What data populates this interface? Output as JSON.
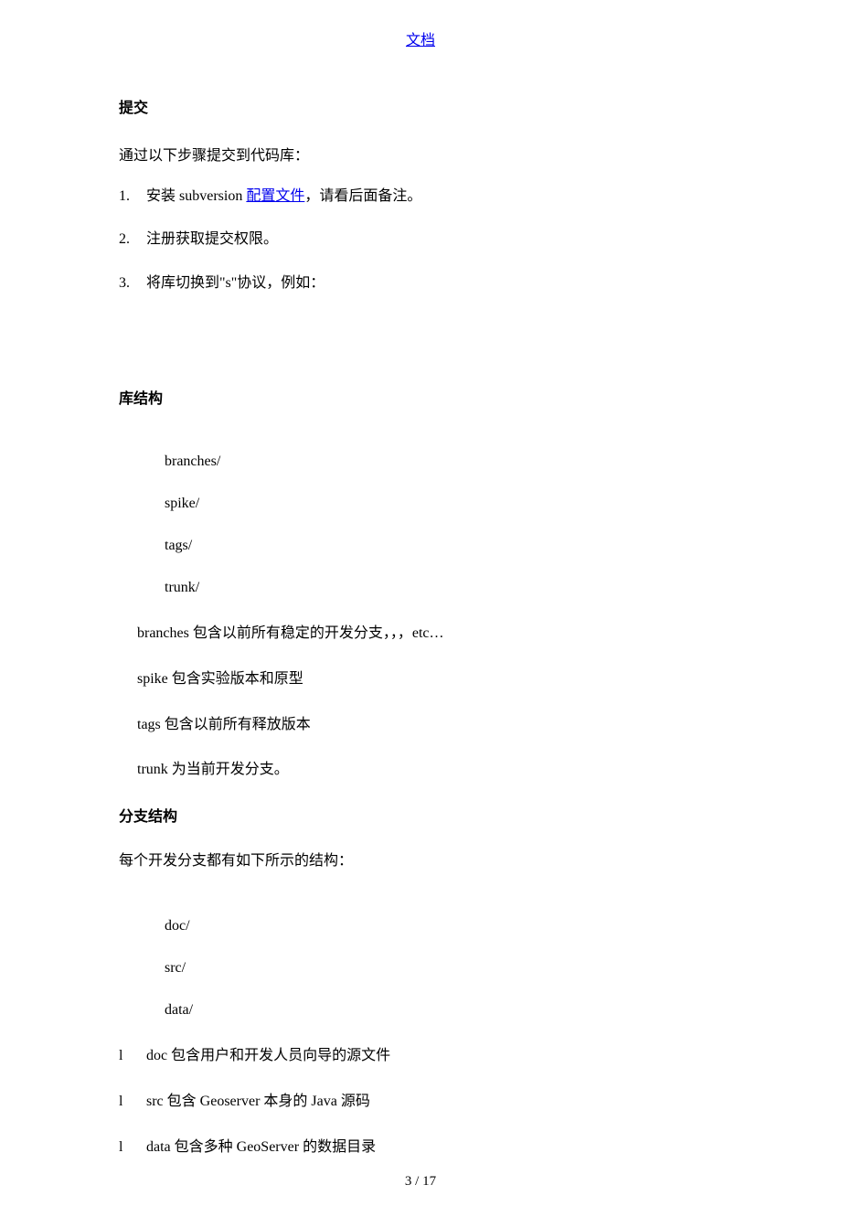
{
  "header": {
    "doc_link": "文档"
  },
  "section1": {
    "title": "提交",
    "intro": "通过以下步骤提交到代码库：",
    "steps": [
      {
        "num": "1.",
        "prefix": "安装 subversion ",
        "link": "配置文件",
        "suffix": "，请看后面备注。"
      },
      {
        "num": "2.",
        "text": "注册获取提交权限。"
      },
      {
        "num": "3.",
        "text": "将库切换到\"s\"协议，例如："
      }
    ]
  },
  "section2": {
    "title": "库结构",
    "tree": [
      "branches/",
      "spike/",
      "tags/",
      "trunk/"
    ],
    "desc": [
      "branches 包含以前所有稳定的开发分支，，，etc…",
      "spike 包含实验版本和原型",
      "tags 包含以前所有释放版本",
      "trunk 为当前开发分支。"
    ]
  },
  "section3": {
    "title": "分支结构",
    "intro": "每个开发分支都有如下所示的结构：",
    "tree": [
      "doc/",
      "src/",
      "data/"
    ],
    "bullets": [
      {
        "marker": "l",
        "text": "doc 包含用户和开发人员向导的源文件"
      },
      {
        "marker": "l",
        "text": "src 包含 Geoserver 本身的 Java 源码"
      },
      {
        "marker": "l",
        "text": "data 包含多种 GeoServer 的数据目录"
      }
    ]
  },
  "footer": {
    "page": "3 / 17"
  }
}
